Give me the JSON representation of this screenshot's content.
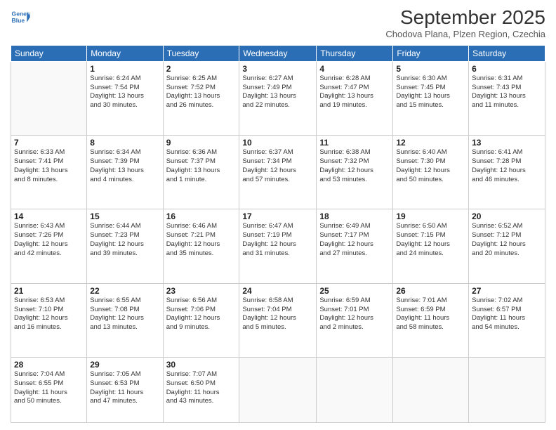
{
  "header": {
    "logo_line1": "General",
    "logo_line2": "Blue",
    "title": "September 2025",
    "subtitle": "Chodova Plana, Plzen Region, Czechia"
  },
  "weekdays": [
    "Sunday",
    "Monday",
    "Tuesday",
    "Wednesday",
    "Thursday",
    "Friday",
    "Saturday"
  ],
  "weeks": [
    [
      {
        "day": "",
        "info": ""
      },
      {
        "day": "1",
        "info": "Sunrise: 6:24 AM\nSunset: 7:54 PM\nDaylight: 13 hours\nand 30 minutes."
      },
      {
        "day": "2",
        "info": "Sunrise: 6:25 AM\nSunset: 7:52 PM\nDaylight: 13 hours\nand 26 minutes."
      },
      {
        "day": "3",
        "info": "Sunrise: 6:27 AM\nSunset: 7:49 PM\nDaylight: 13 hours\nand 22 minutes."
      },
      {
        "day": "4",
        "info": "Sunrise: 6:28 AM\nSunset: 7:47 PM\nDaylight: 13 hours\nand 19 minutes."
      },
      {
        "day": "5",
        "info": "Sunrise: 6:30 AM\nSunset: 7:45 PM\nDaylight: 13 hours\nand 15 minutes."
      },
      {
        "day": "6",
        "info": "Sunrise: 6:31 AM\nSunset: 7:43 PM\nDaylight: 13 hours\nand 11 minutes."
      }
    ],
    [
      {
        "day": "7",
        "info": "Sunrise: 6:33 AM\nSunset: 7:41 PM\nDaylight: 13 hours\nand 8 minutes."
      },
      {
        "day": "8",
        "info": "Sunrise: 6:34 AM\nSunset: 7:39 PM\nDaylight: 13 hours\nand 4 minutes."
      },
      {
        "day": "9",
        "info": "Sunrise: 6:36 AM\nSunset: 7:37 PM\nDaylight: 13 hours\nand 1 minute."
      },
      {
        "day": "10",
        "info": "Sunrise: 6:37 AM\nSunset: 7:34 PM\nDaylight: 12 hours\nand 57 minutes."
      },
      {
        "day": "11",
        "info": "Sunrise: 6:38 AM\nSunset: 7:32 PM\nDaylight: 12 hours\nand 53 minutes."
      },
      {
        "day": "12",
        "info": "Sunrise: 6:40 AM\nSunset: 7:30 PM\nDaylight: 12 hours\nand 50 minutes."
      },
      {
        "day": "13",
        "info": "Sunrise: 6:41 AM\nSunset: 7:28 PM\nDaylight: 12 hours\nand 46 minutes."
      }
    ],
    [
      {
        "day": "14",
        "info": "Sunrise: 6:43 AM\nSunset: 7:26 PM\nDaylight: 12 hours\nand 42 minutes."
      },
      {
        "day": "15",
        "info": "Sunrise: 6:44 AM\nSunset: 7:23 PM\nDaylight: 12 hours\nand 39 minutes."
      },
      {
        "day": "16",
        "info": "Sunrise: 6:46 AM\nSunset: 7:21 PM\nDaylight: 12 hours\nand 35 minutes."
      },
      {
        "day": "17",
        "info": "Sunrise: 6:47 AM\nSunset: 7:19 PM\nDaylight: 12 hours\nand 31 minutes."
      },
      {
        "day": "18",
        "info": "Sunrise: 6:49 AM\nSunset: 7:17 PM\nDaylight: 12 hours\nand 27 minutes."
      },
      {
        "day": "19",
        "info": "Sunrise: 6:50 AM\nSunset: 7:15 PM\nDaylight: 12 hours\nand 24 minutes."
      },
      {
        "day": "20",
        "info": "Sunrise: 6:52 AM\nSunset: 7:12 PM\nDaylight: 12 hours\nand 20 minutes."
      }
    ],
    [
      {
        "day": "21",
        "info": "Sunrise: 6:53 AM\nSunset: 7:10 PM\nDaylight: 12 hours\nand 16 minutes."
      },
      {
        "day": "22",
        "info": "Sunrise: 6:55 AM\nSunset: 7:08 PM\nDaylight: 12 hours\nand 13 minutes."
      },
      {
        "day": "23",
        "info": "Sunrise: 6:56 AM\nSunset: 7:06 PM\nDaylight: 12 hours\nand 9 minutes."
      },
      {
        "day": "24",
        "info": "Sunrise: 6:58 AM\nSunset: 7:04 PM\nDaylight: 12 hours\nand 5 minutes."
      },
      {
        "day": "25",
        "info": "Sunrise: 6:59 AM\nSunset: 7:01 PM\nDaylight: 12 hours\nand 2 minutes."
      },
      {
        "day": "26",
        "info": "Sunrise: 7:01 AM\nSunset: 6:59 PM\nDaylight: 11 hours\nand 58 minutes."
      },
      {
        "day": "27",
        "info": "Sunrise: 7:02 AM\nSunset: 6:57 PM\nDaylight: 11 hours\nand 54 minutes."
      }
    ],
    [
      {
        "day": "28",
        "info": "Sunrise: 7:04 AM\nSunset: 6:55 PM\nDaylight: 11 hours\nand 50 minutes."
      },
      {
        "day": "29",
        "info": "Sunrise: 7:05 AM\nSunset: 6:53 PM\nDaylight: 11 hours\nand 47 minutes."
      },
      {
        "day": "30",
        "info": "Sunrise: 7:07 AM\nSunset: 6:50 PM\nDaylight: 11 hours\nand 43 minutes."
      },
      {
        "day": "",
        "info": ""
      },
      {
        "day": "",
        "info": ""
      },
      {
        "day": "",
        "info": ""
      },
      {
        "day": "",
        "info": ""
      }
    ]
  ]
}
